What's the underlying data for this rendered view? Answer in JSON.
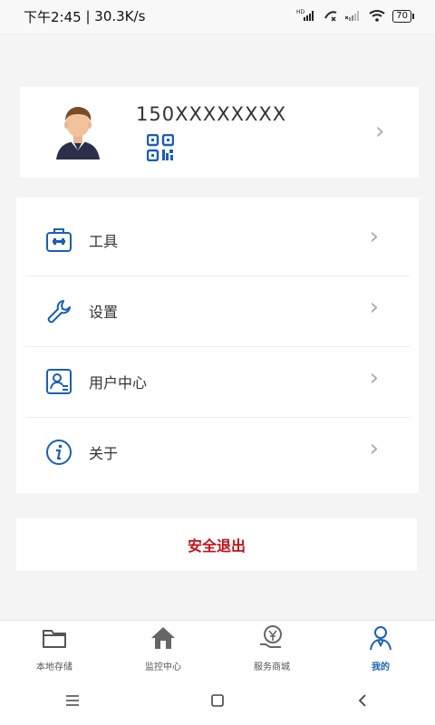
{
  "status_bar": {
    "time": "下午2:45",
    "speed": "30.3K/s",
    "battery": "70",
    "hd": "HD"
  },
  "profile": {
    "phone": "150XXXXXXXX"
  },
  "menu": {
    "items": [
      {
        "label": "工具",
        "icon": "toolbox-icon"
      },
      {
        "label": "设置",
        "icon": "wrench-icon"
      },
      {
        "label": "用户中心",
        "icon": "user-card-icon"
      },
      {
        "label": "关于",
        "icon": "info-icon"
      }
    ]
  },
  "logout_label": "安全退出",
  "tabbar": {
    "tabs": [
      {
        "label": "本地存储",
        "icon": "folder-icon"
      },
      {
        "label": "监控中心",
        "icon": "home-icon"
      },
      {
        "label": "服务商城",
        "icon": "service-hand-icon"
      },
      {
        "label": "我的",
        "icon": "profile-icon"
      }
    ]
  },
  "colors": {
    "accent": "#1a5fb4",
    "logout": "#c4121a",
    "background": "#f4f4f4"
  }
}
